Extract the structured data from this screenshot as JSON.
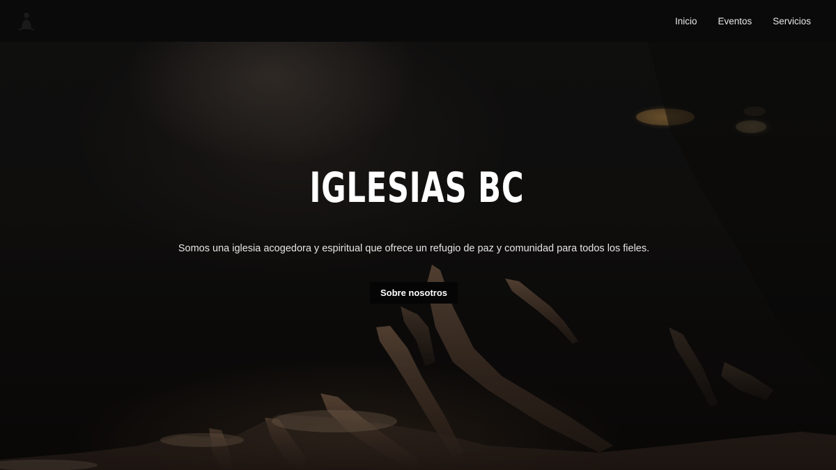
{
  "nav": {
    "logo_icon": "praying-person-icon",
    "links": [
      {
        "label": "Inicio"
      },
      {
        "label": "Eventos"
      },
      {
        "label": "Servicios"
      }
    ]
  },
  "hero": {
    "title": "IGLESIAS BC",
    "subtitle": "Somos una iglesia acogedora y espiritual que ofrece un refugio de paz y comunidad para todos los fieles.",
    "cta_label": "Sobre nosotros",
    "background_icon": "worship-crowd-raised-hands-photo"
  },
  "colors": {
    "navbar_bg": "#0a0a0b",
    "text": "#ffffff",
    "button_bg": "#050505"
  }
}
